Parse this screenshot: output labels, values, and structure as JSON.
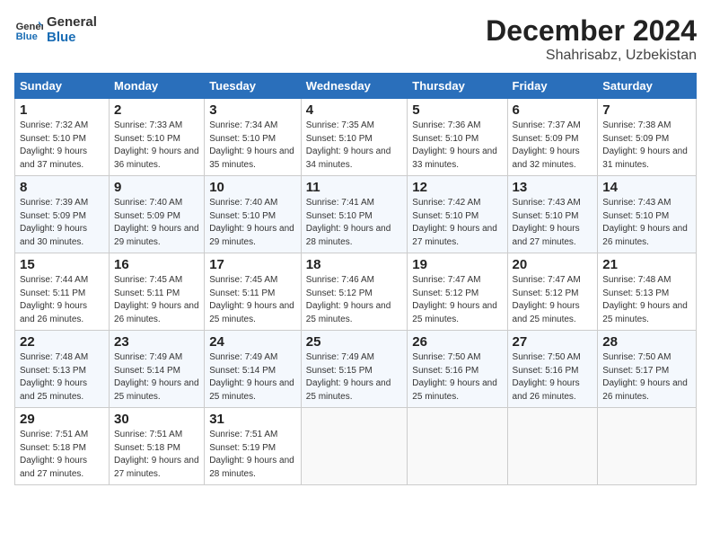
{
  "logo": {
    "line1": "General",
    "line2": "Blue"
  },
  "title": "December 2024",
  "subtitle": "Shahrisabz, Uzbekistan",
  "weekdays": [
    "Sunday",
    "Monday",
    "Tuesday",
    "Wednesday",
    "Thursday",
    "Friday",
    "Saturday"
  ],
  "weeks": [
    [
      {
        "day": 1,
        "sunrise": "7:32 AM",
        "sunset": "5:10 PM",
        "daylight": "9 hours and 37 minutes."
      },
      {
        "day": 2,
        "sunrise": "7:33 AM",
        "sunset": "5:10 PM",
        "daylight": "9 hours and 36 minutes."
      },
      {
        "day": 3,
        "sunrise": "7:34 AM",
        "sunset": "5:10 PM",
        "daylight": "9 hours and 35 minutes."
      },
      {
        "day": 4,
        "sunrise": "7:35 AM",
        "sunset": "5:10 PM",
        "daylight": "9 hours and 34 minutes."
      },
      {
        "day": 5,
        "sunrise": "7:36 AM",
        "sunset": "5:10 PM",
        "daylight": "9 hours and 33 minutes."
      },
      {
        "day": 6,
        "sunrise": "7:37 AM",
        "sunset": "5:09 PM",
        "daylight": "9 hours and 32 minutes."
      },
      {
        "day": 7,
        "sunrise": "7:38 AM",
        "sunset": "5:09 PM",
        "daylight": "9 hours and 31 minutes."
      }
    ],
    [
      {
        "day": 8,
        "sunrise": "7:39 AM",
        "sunset": "5:09 PM",
        "daylight": "9 hours and 30 minutes."
      },
      {
        "day": 9,
        "sunrise": "7:40 AM",
        "sunset": "5:09 PM",
        "daylight": "9 hours and 29 minutes."
      },
      {
        "day": 10,
        "sunrise": "7:40 AM",
        "sunset": "5:10 PM",
        "daylight": "9 hours and 29 minutes."
      },
      {
        "day": 11,
        "sunrise": "7:41 AM",
        "sunset": "5:10 PM",
        "daylight": "9 hours and 28 minutes."
      },
      {
        "day": 12,
        "sunrise": "7:42 AM",
        "sunset": "5:10 PM",
        "daylight": "9 hours and 27 minutes."
      },
      {
        "day": 13,
        "sunrise": "7:43 AM",
        "sunset": "5:10 PM",
        "daylight": "9 hours and 27 minutes."
      },
      {
        "day": 14,
        "sunrise": "7:43 AM",
        "sunset": "5:10 PM",
        "daylight": "9 hours and 26 minutes."
      }
    ],
    [
      {
        "day": 15,
        "sunrise": "7:44 AM",
        "sunset": "5:11 PM",
        "daylight": "9 hours and 26 minutes."
      },
      {
        "day": 16,
        "sunrise": "7:45 AM",
        "sunset": "5:11 PM",
        "daylight": "9 hours and 26 minutes."
      },
      {
        "day": 17,
        "sunrise": "7:45 AM",
        "sunset": "5:11 PM",
        "daylight": "9 hours and 25 minutes."
      },
      {
        "day": 18,
        "sunrise": "7:46 AM",
        "sunset": "5:12 PM",
        "daylight": "9 hours and 25 minutes."
      },
      {
        "day": 19,
        "sunrise": "7:47 AM",
        "sunset": "5:12 PM",
        "daylight": "9 hours and 25 minutes."
      },
      {
        "day": 20,
        "sunrise": "7:47 AM",
        "sunset": "5:12 PM",
        "daylight": "9 hours and 25 minutes."
      },
      {
        "day": 21,
        "sunrise": "7:48 AM",
        "sunset": "5:13 PM",
        "daylight": "9 hours and 25 minutes."
      }
    ],
    [
      {
        "day": 22,
        "sunrise": "7:48 AM",
        "sunset": "5:13 PM",
        "daylight": "9 hours and 25 minutes."
      },
      {
        "day": 23,
        "sunrise": "7:49 AM",
        "sunset": "5:14 PM",
        "daylight": "9 hours and 25 minutes."
      },
      {
        "day": 24,
        "sunrise": "7:49 AM",
        "sunset": "5:14 PM",
        "daylight": "9 hours and 25 minutes."
      },
      {
        "day": 25,
        "sunrise": "7:49 AM",
        "sunset": "5:15 PM",
        "daylight": "9 hours and 25 minutes."
      },
      {
        "day": 26,
        "sunrise": "7:50 AM",
        "sunset": "5:16 PM",
        "daylight": "9 hours and 25 minutes."
      },
      {
        "day": 27,
        "sunrise": "7:50 AM",
        "sunset": "5:16 PM",
        "daylight": "9 hours and 26 minutes."
      },
      {
        "day": 28,
        "sunrise": "7:50 AM",
        "sunset": "5:17 PM",
        "daylight": "9 hours and 26 minutes."
      }
    ],
    [
      {
        "day": 29,
        "sunrise": "7:51 AM",
        "sunset": "5:18 PM",
        "daylight": "9 hours and 27 minutes."
      },
      {
        "day": 30,
        "sunrise": "7:51 AM",
        "sunset": "5:18 PM",
        "daylight": "9 hours and 27 minutes."
      },
      {
        "day": 31,
        "sunrise": "7:51 AM",
        "sunset": "5:19 PM",
        "daylight": "9 hours and 28 minutes."
      },
      null,
      null,
      null,
      null
    ]
  ]
}
